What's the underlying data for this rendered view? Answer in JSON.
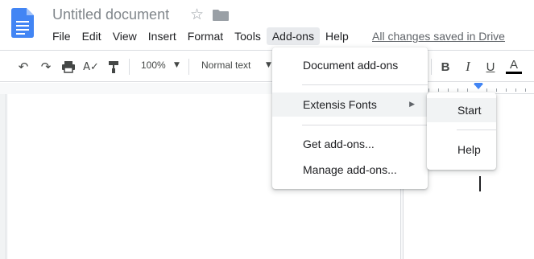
{
  "document": {
    "title": "Untitled document"
  },
  "menubar": {
    "items": [
      "File",
      "Edit",
      "View",
      "Insert",
      "Format",
      "Tools",
      "Add-ons",
      "Help"
    ],
    "saved_status": "All changes saved in Drive"
  },
  "toolbar": {
    "zoom": "100%",
    "style": "Normal text"
  },
  "addons_menu": {
    "items": [
      "Document add-ons",
      "Extensis Fonts",
      "Get add-ons...",
      "Manage add-ons..."
    ]
  },
  "submenu": {
    "items": [
      "Start",
      "Help"
    ]
  },
  "colors": {
    "accent": "#4285f4",
    "highlight": "#e8eaed",
    "text": "#202124"
  },
  "icons": [
    "docs-icon",
    "star-icon",
    "folder-icon",
    "undo-icon",
    "redo-icon",
    "print-icon",
    "spellcheck-icon",
    "paint-format-icon",
    "bold-icon",
    "italic-icon",
    "underline-icon",
    "text-color-icon"
  ]
}
